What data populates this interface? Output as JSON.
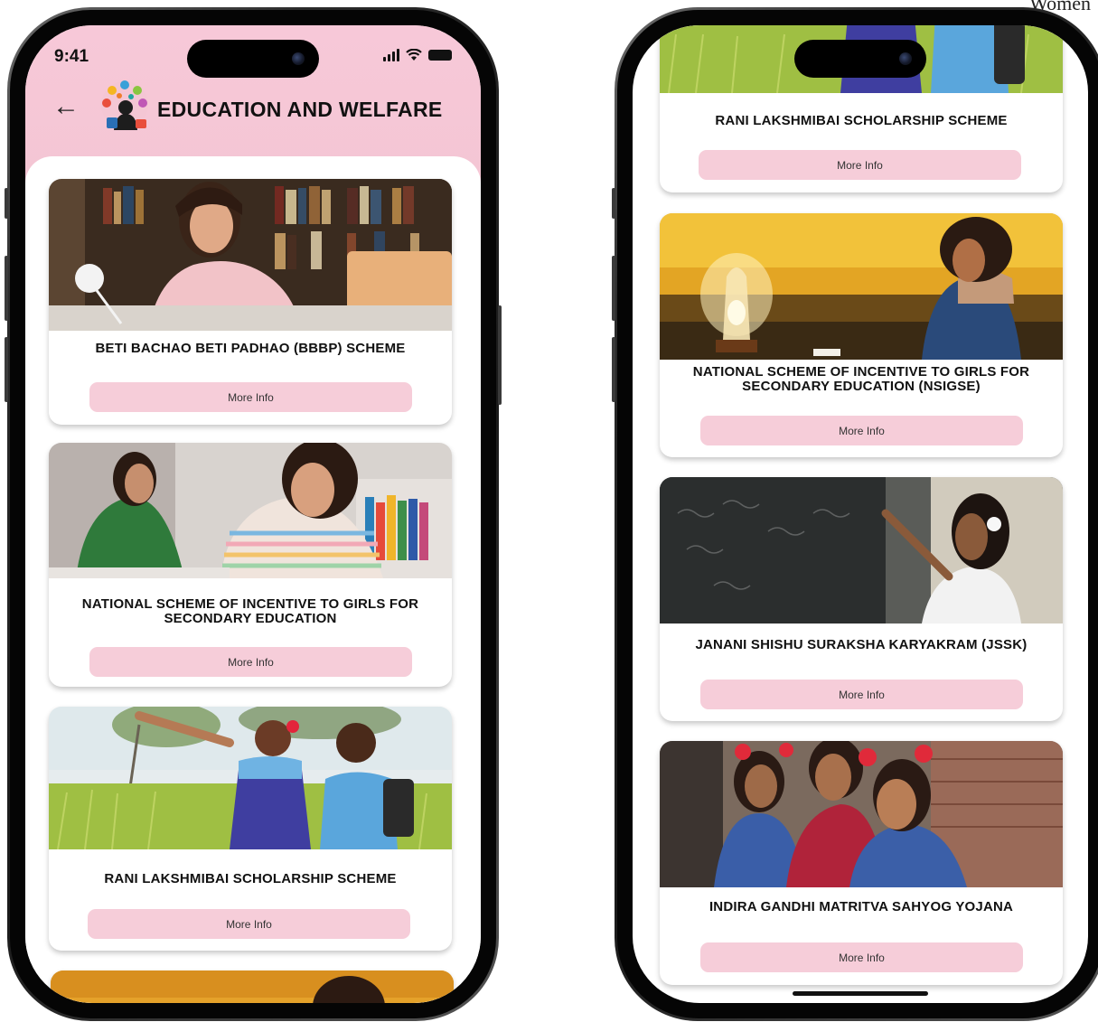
{
  "corner_text": "Women",
  "status_bar": {
    "time": "9:41"
  },
  "header": {
    "title": "EDUCATION AND WELFARE",
    "back_icon": "arrow-left-icon"
  },
  "colors": {
    "header_bg": "#f7c8d8",
    "button_bg": "#f6cdd9",
    "text": "#111111"
  },
  "left_screen": {
    "cards": [
      {
        "title": "BETI BACHAO BETI PADHAO (BBBP) SCHEME",
        "button": "More Info"
      },
      {
        "title": "NATIONAL SCHEME OF INCENTIVE TO GIRLS FOR SECONDARY EDUCATION",
        "button": "More Info"
      },
      {
        "title": "RANI LAKSHMIBAI SCHOLARSHIP SCHEME",
        "button": "More Info"
      }
    ]
  },
  "right_screen": {
    "cards": [
      {
        "title": "RANI LAKSHMIBAI SCHOLARSHIP SCHEME",
        "button": "More Info"
      },
      {
        "title": "NATIONAL SCHEME OF INCENTIVE TO GIRLS FOR SECONDARY EDUCATION (NSIGSE)",
        "button": "More Info"
      },
      {
        "title": "JANANI SHISHU SURAKSHA KARYAKRAM (JSSK)",
        "button": "More Info"
      },
      {
        "title": "INDIRA GANDHI MATRITVA SAHYOG YOJANA",
        "button": "More Info"
      }
    ]
  }
}
